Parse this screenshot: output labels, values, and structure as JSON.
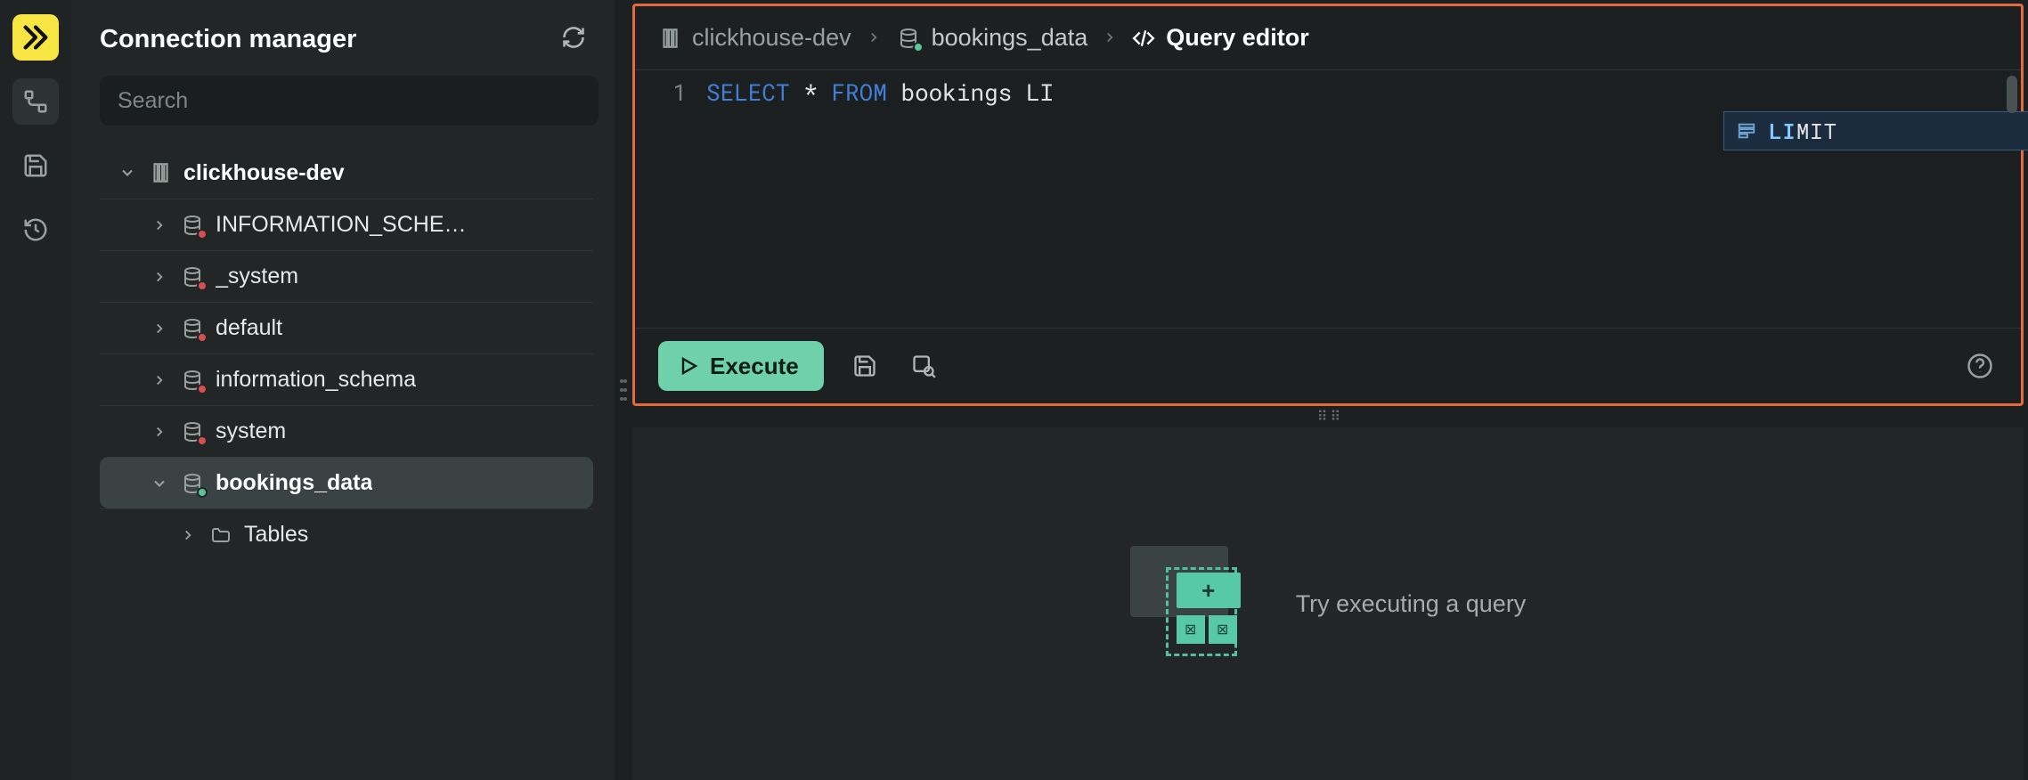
{
  "sidebar": {
    "title": "Connection manager",
    "search_placeholder": "Search"
  },
  "tree": {
    "connection": {
      "name": "clickhouse-dev",
      "status": "connected"
    },
    "databases": [
      {
        "name": "INFORMATION_SCHE…",
        "status": "red",
        "expanded": false,
        "active": false
      },
      {
        "name": "_system",
        "status": "red",
        "expanded": false,
        "active": false
      },
      {
        "name": "default",
        "status": "red",
        "expanded": false,
        "active": false
      },
      {
        "name": "information_schema",
        "status": "red",
        "expanded": false,
        "active": false
      },
      {
        "name": "system",
        "status": "red",
        "expanded": false,
        "active": false
      },
      {
        "name": "bookings_data",
        "status": "green",
        "expanded": true,
        "active": true
      }
    ],
    "child_label": "Tables"
  },
  "breadcrumbs": {
    "connection": "clickhouse-dev",
    "database": "bookings_data",
    "page": "Query editor"
  },
  "editor": {
    "line_number": "1",
    "tokens": {
      "select": "SELECT",
      "star": " * ",
      "from": "FROM",
      "rest": " bookings LI"
    },
    "autocomplete": {
      "typed": "LI",
      "rest": "MIT",
      "kind": "Keyword"
    }
  },
  "toolbar": {
    "execute_label": "Execute"
  },
  "results": {
    "placeholder": "Try executing a query"
  }
}
